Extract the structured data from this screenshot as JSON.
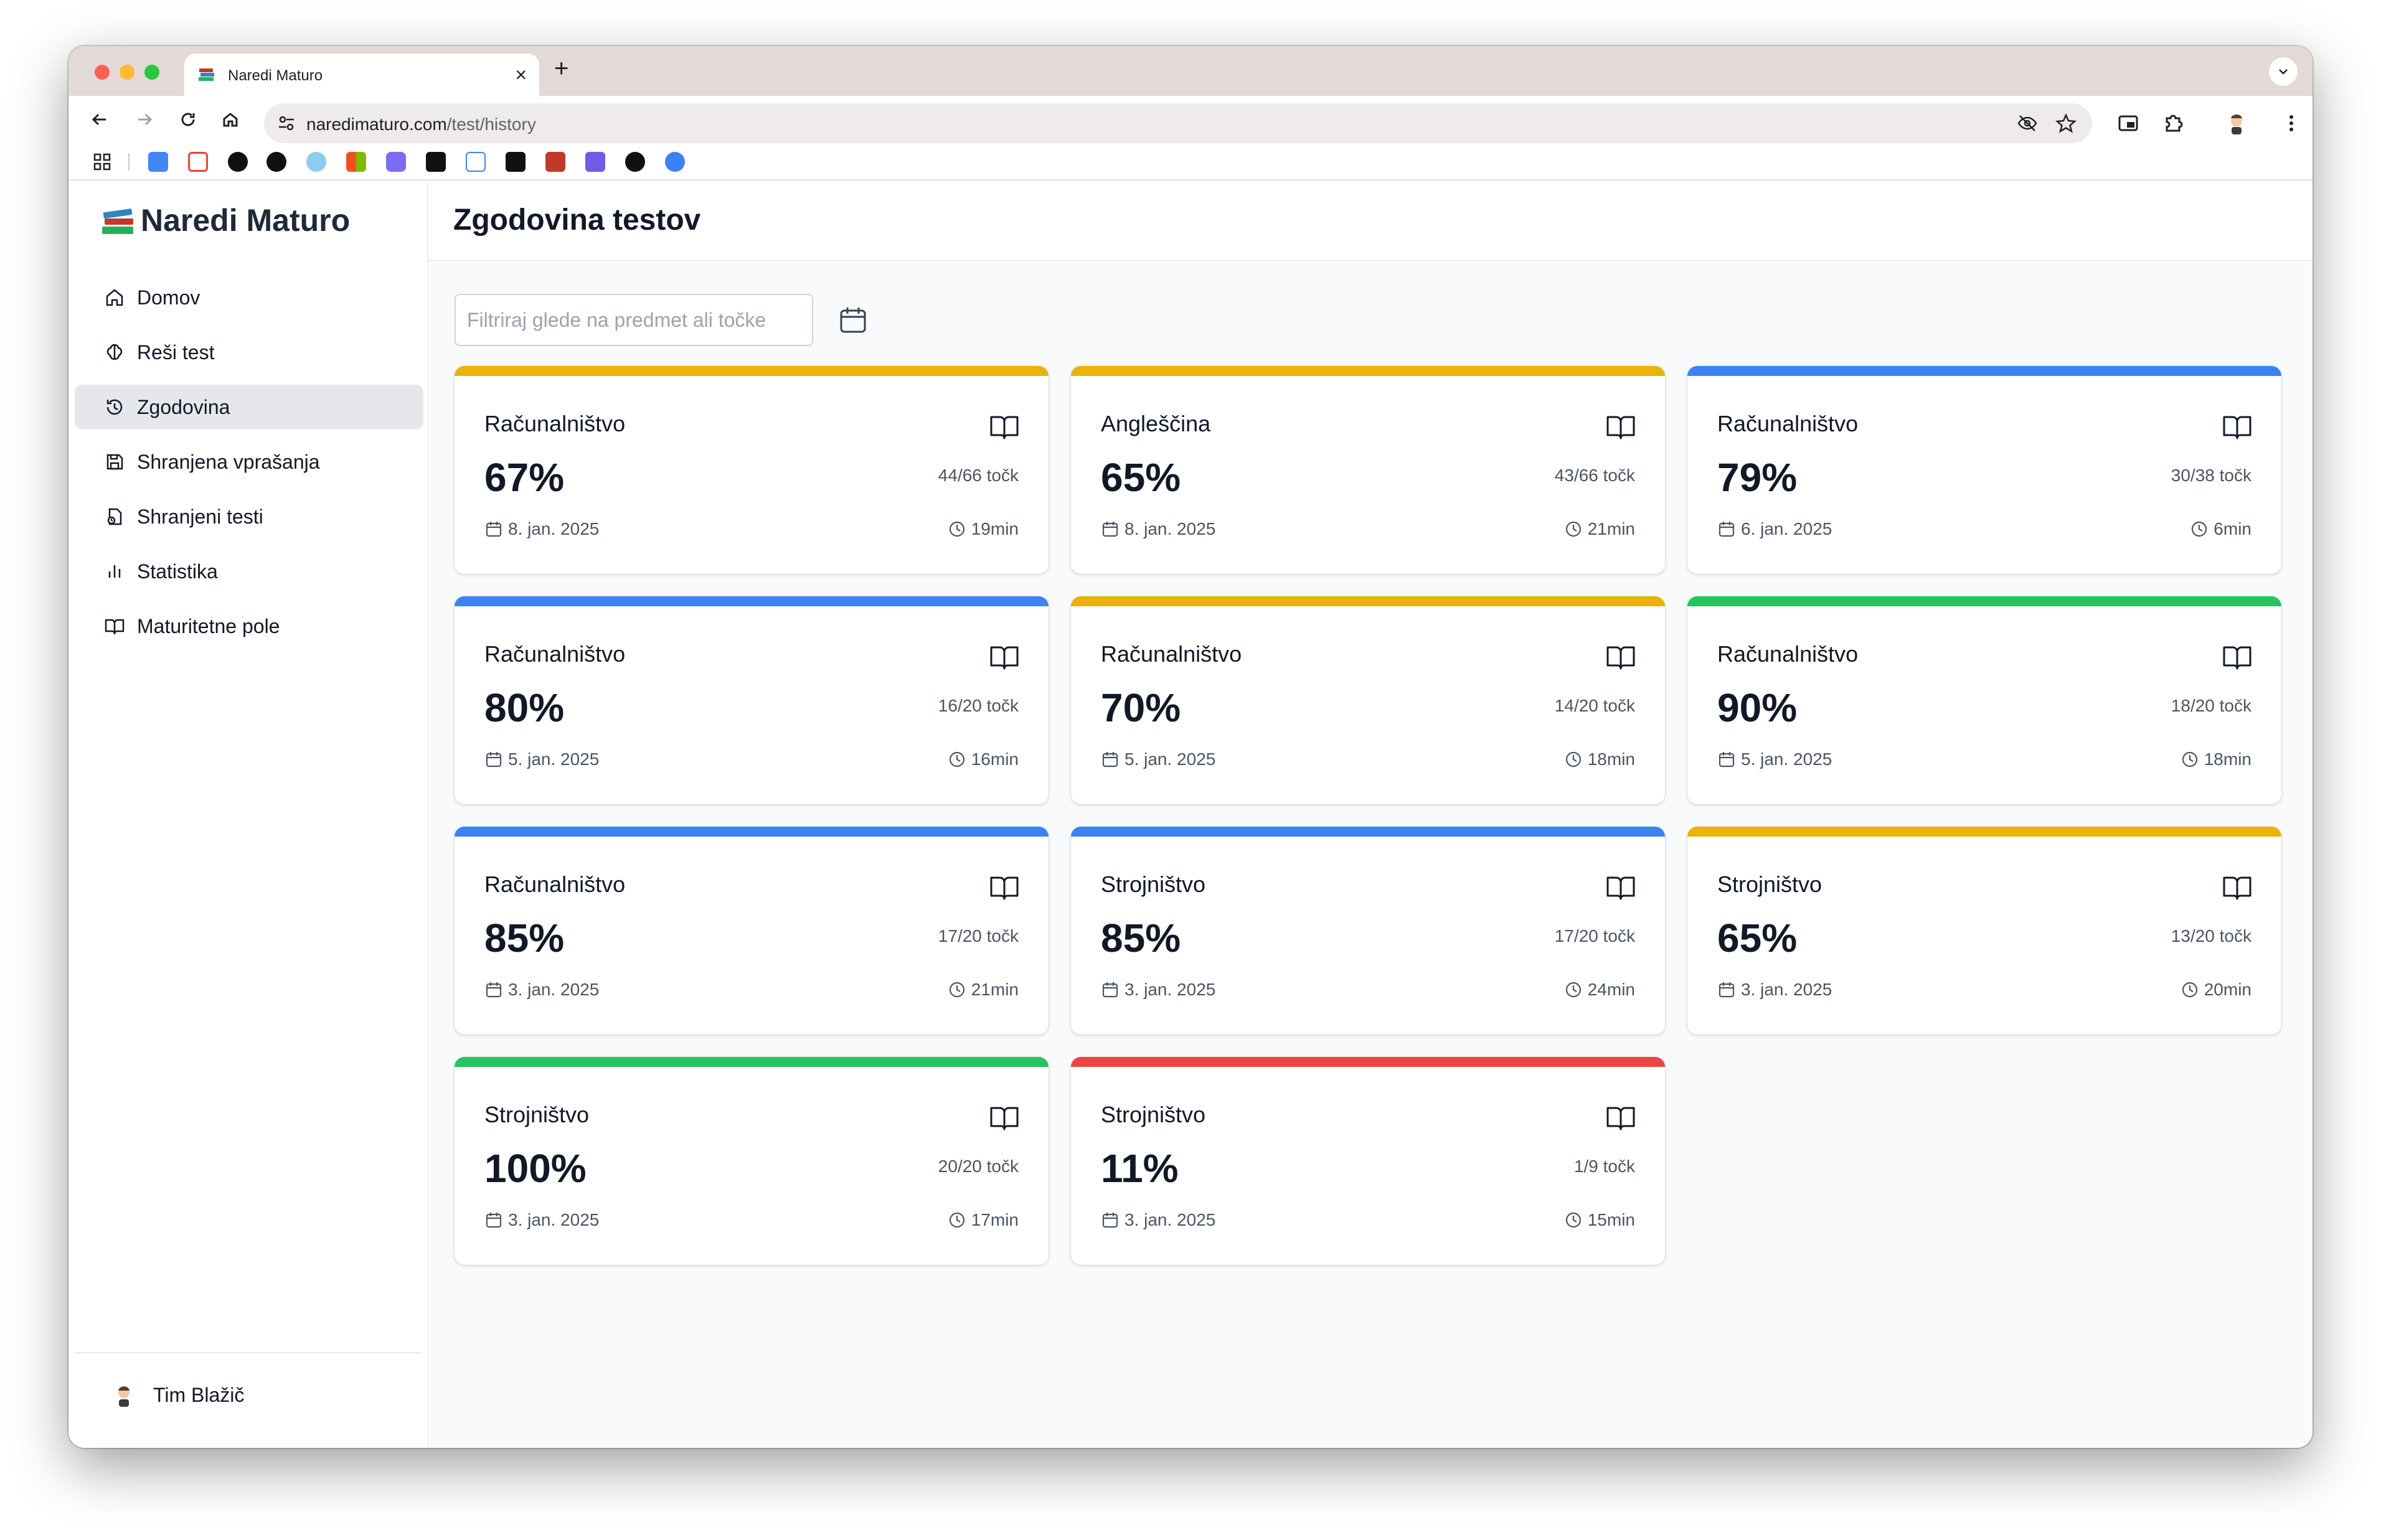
{
  "browser": {
    "tab_title": "Naredi Maturo",
    "url_domain": "naredimaturo.com",
    "url_path": "/test/history",
    "new_tab_icon": "plus-icon",
    "close_icon": "close-icon"
  },
  "app": {
    "brand": "Naredi Maturo",
    "page_title": "Zgodovina testov",
    "filter_placeholder": "Filtriraj glede na predmet ali točke",
    "sidebar": {
      "items": [
        {
          "label": "Domov",
          "icon": "home-icon",
          "active": false
        },
        {
          "label": "Reši test",
          "icon": "brain-icon",
          "active": false
        },
        {
          "label": "Zgodovina",
          "icon": "history-icon",
          "active": true
        },
        {
          "label": "Shranjena vprašanja",
          "icon": "save-icon",
          "active": false
        },
        {
          "label": "Shranjeni testi",
          "icon": "saved-tests-icon",
          "active": false
        },
        {
          "label": "Statistika",
          "icon": "bar-chart-icon",
          "active": false
        },
        {
          "label": "Maturitetne pole",
          "icon": "book-icon",
          "active": false
        }
      ],
      "user": "Tim Blažič"
    },
    "colors": {
      "yellow": "#eab308",
      "blue": "#3b82f6",
      "green": "#22c55e",
      "red": "#ef4444"
    },
    "cards": [
      {
        "subject": "Računalništvo",
        "score": "67%",
        "points": "44/66 točk",
        "date": "8. jan. 2025",
        "time": "19min",
        "color": "#eab308"
      },
      {
        "subject": "Angleščina",
        "score": "65%",
        "points": "43/66 točk",
        "date": "8. jan. 2025",
        "time": "21min",
        "color": "#eab308"
      },
      {
        "subject": "Računalništvo",
        "score": "79%",
        "points": "30/38 točk",
        "date": "6. jan. 2025",
        "time": "6min",
        "color": "#3b82f6"
      },
      {
        "subject": "Računalništvo",
        "score": "80%",
        "points": "16/20 točk",
        "date": "5. jan. 2025",
        "time": "16min",
        "color": "#3b82f6"
      },
      {
        "subject": "Računalništvo",
        "score": "70%",
        "points": "14/20 točk",
        "date": "5. jan. 2025",
        "time": "18min",
        "color": "#eab308"
      },
      {
        "subject": "Računalništvo",
        "score": "90%",
        "points": "18/20 točk",
        "date": "5. jan. 2025",
        "time": "18min",
        "color": "#22c55e"
      },
      {
        "subject": "Računalništvo",
        "score": "85%",
        "points": "17/20 točk",
        "date": "3. jan. 2025",
        "time": "21min",
        "color": "#3b82f6"
      },
      {
        "subject": "Strojništvo",
        "score": "85%",
        "points": "17/20 točk",
        "date": "3. jan. 2025",
        "time": "24min",
        "color": "#3b82f6"
      },
      {
        "subject": "Strojništvo",
        "score": "65%",
        "points": "13/20 točk",
        "date": "3. jan. 2025",
        "time": "20min",
        "color": "#eab308"
      },
      {
        "subject": "Strojništvo",
        "score": "100%",
        "points": "20/20 točk",
        "date": "3. jan. 2025",
        "time": "17min",
        "color": "#22c55e"
      },
      {
        "subject": "Strojništvo",
        "score": "11%",
        "points": "1/9 točk",
        "date": "3. jan. 2025",
        "time": "15min",
        "color": "#ef4444"
      }
    ]
  }
}
